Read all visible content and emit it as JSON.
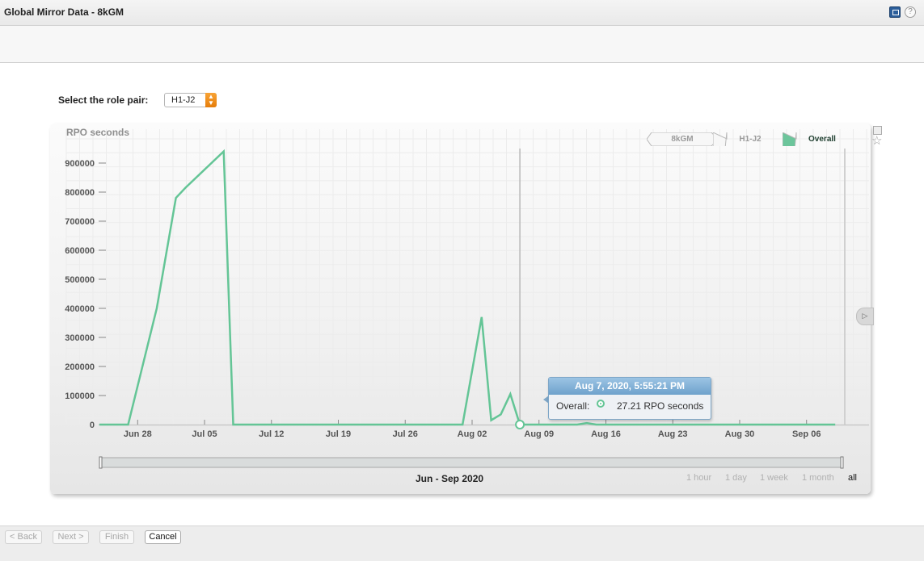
{
  "window": {
    "title": "Global Mirror Data - 8kGM",
    "window_icon": "window-restore-icon",
    "help_icon": "help-icon",
    "help_glyph": "?"
  },
  "role_pair": {
    "label": "Select the role pair:",
    "value": "H1-J2"
  },
  "chart_header": {
    "breadcrumbs": [
      {
        "label": "8kGM",
        "active": false
      },
      {
        "label": "H1-J2",
        "active": false
      },
      {
        "label": "Overall",
        "active": true
      }
    ]
  },
  "tooltip": {
    "title": "Aug 7, 2020, 5:55:21 PM",
    "series_label": "Overall:",
    "value_text": "27.21 RPO seconds"
  },
  "range": {
    "label": "Jun - Sep 2020",
    "zoom_options": [
      "1 hour",
      "1 day",
      "1 week",
      "1 month",
      "all"
    ],
    "selected": "all"
  },
  "footer": {
    "buttons": [
      {
        "label": "< Back",
        "enabled": false
      },
      {
        "label": "Next >",
        "enabled": false
      },
      {
        "label": "Finish",
        "enabled": false
      },
      {
        "label": "Cancel",
        "enabled": true
      }
    ]
  },
  "colors": {
    "series": "#64c596",
    "crumb_active": "#6cc59b",
    "tooltip_header": "#7fb0d8"
  },
  "chart_data": {
    "type": "line",
    "title": "",
    "ylabel": "RPO seconds",
    "xlabel": "",
    "ylim": [
      0,
      950000
    ],
    "yticks": [
      0,
      100000,
      200000,
      300000,
      400000,
      500000,
      600000,
      700000,
      800000,
      900000
    ],
    "xlim": [
      "2020-06-24",
      "2020-09-10"
    ],
    "xticks": [
      {
        "label": "Jun 28",
        "date": "2020-06-28"
      },
      {
        "label": "Jul 05",
        "date": "2020-07-05"
      },
      {
        "label": "Jul 12",
        "date": "2020-07-12"
      },
      {
        "label": "Jul 19",
        "date": "2020-07-19"
      },
      {
        "label": "Jul 26",
        "date": "2020-07-26"
      },
      {
        "label": "Aug 02",
        "date": "2020-08-02"
      },
      {
        "label": "Aug 09",
        "date": "2020-08-09"
      },
      {
        "label": "Aug 16",
        "date": "2020-08-16"
      },
      {
        "label": "Aug 23",
        "date": "2020-08-23"
      },
      {
        "label": "Aug 30",
        "date": "2020-08-30"
      },
      {
        "label": "Sep 06",
        "date": "2020-09-06"
      }
    ],
    "grid": true,
    "series": [
      {
        "name": "Overall",
        "points": [
          [
            "2020-06-24",
            0
          ],
          [
            "2020-06-27",
            0
          ],
          [
            "2020-06-30",
            400000
          ],
          [
            "2020-07-02",
            780000
          ],
          [
            "2020-07-03",
            815000
          ],
          [
            "2020-07-07",
            940000
          ],
          [
            "2020-07-08",
            0
          ],
          [
            "2020-08-01",
            0
          ],
          [
            "2020-08-03",
            370000
          ],
          [
            "2020-08-04",
            15000
          ],
          [
            "2020-08-05",
            35000
          ],
          [
            "2020-08-06",
            105000
          ],
          [
            "2020-08-07",
            27.21
          ],
          [
            "2020-08-13",
            0
          ],
          [
            "2020-08-14",
            5000
          ],
          [
            "2020-08-15",
            0
          ],
          [
            "2020-09-09",
            0
          ]
        ]
      }
    ],
    "highlight": {
      "date": "2020-08-07",
      "value": 27.21
    }
  }
}
